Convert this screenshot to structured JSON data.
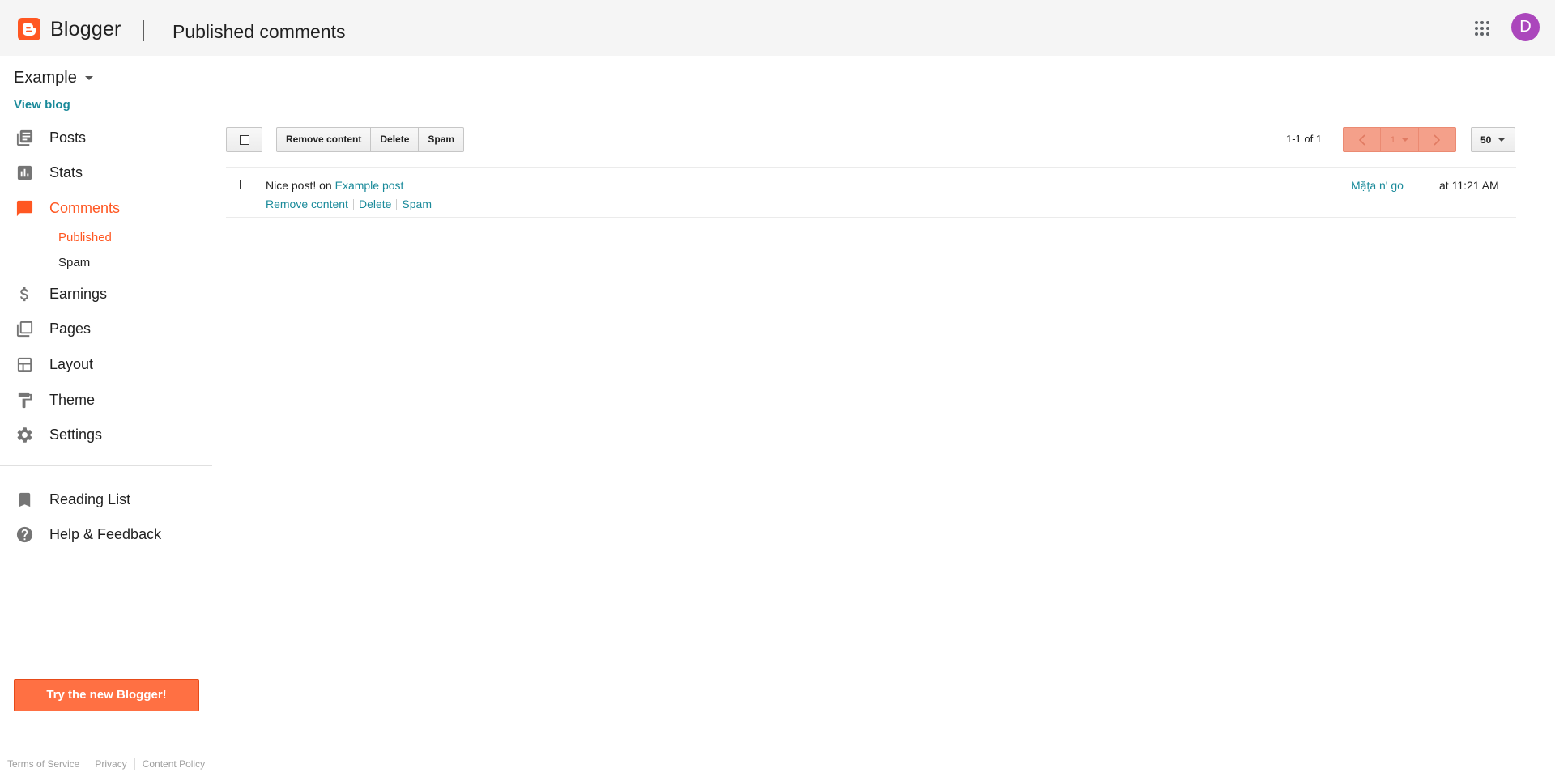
{
  "header": {
    "brand": "Blogger",
    "page_title": "Published comments",
    "avatar_initial": "D",
    "accent_color": "#ff5722",
    "avatar_color": "#ab47bc"
  },
  "sidebar": {
    "blog_name": "Example",
    "view_blog": "View blog",
    "items": [
      {
        "label": "Posts",
        "icon": "posts-icon"
      },
      {
        "label": "Stats",
        "icon": "stats-icon"
      },
      {
        "label": "Comments",
        "icon": "comments-icon",
        "active": true
      },
      {
        "label": "Earnings",
        "icon": "dollar-icon"
      },
      {
        "label": "Pages",
        "icon": "pages-icon"
      },
      {
        "label": "Layout",
        "icon": "layout-icon"
      },
      {
        "label": "Theme",
        "icon": "paint-roller-icon"
      },
      {
        "label": "Settings",
        "icon": "gear-icon"
      }
    ],
    "comment_subitems": [
      {
        "label": "Published",
        "active": true
      },
      {
        "label": "Spam"
      }
    ],
    "secondary_items": [
      {
        "label": "Reading List",
        "icon": "bookmark-icon"
      },
      {
        "label": "Help & Feedback",
        "icon": "help-icon"
      }
    ],
    "try_button": "Try the new Blogger!"
  },
  "footer": {
    "links": [
      "Terms of Service",
      "Privacy",
      "Content Policy"
    ]
  },
  "toolbar": {
    "buttons": [
      "Remove content",
      "Delete",
      "Spam"
    ],
    "range_text": "1-1 of 1",
    "current_page": "1",
    "per_page": "50"
  },
  "comments": [
    {
      "text": "Nice post!",
      "on_label": "on",
      "post_title": "Example post",
      "author": "Mặța n' go",
      "time": "at 11:21 AM",
      "actions": [
        "Remove content",
        "Delete",
        "Spam"
      ]
    }
  ]
}
